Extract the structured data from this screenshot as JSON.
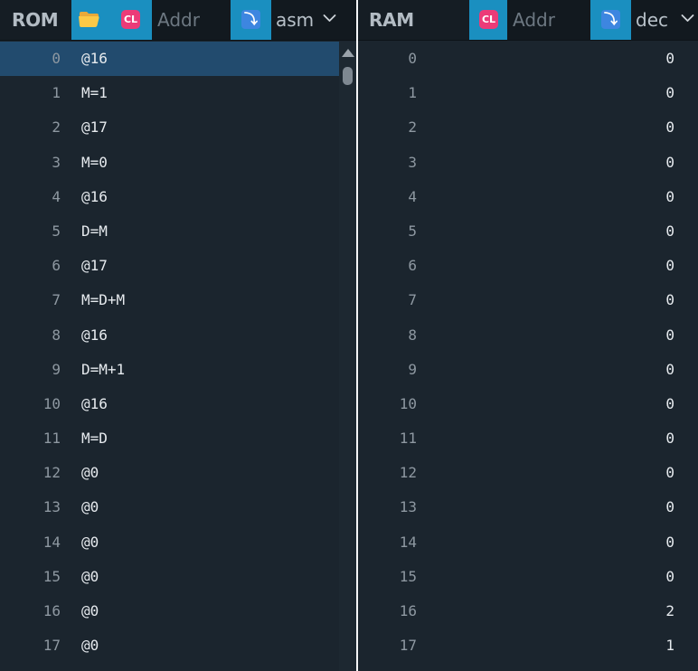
{
  "rom": {
    "title": "ROM",
    "addr_placeholder": "Addr",
    "format": "asm",
    "cl_label": "CL",
    "jump_glyph": "⤵",
    "icons": {
      "load": "folder-icon",
      "clear": "cl-icon",
      "jump": "jump-icon",
      "format": "chevron-down-icon"
    },
    "selected_row": 0,
    "rows": [
      {
        "index": "0",
        "value": "@16"
      },
      {
        "index": "1",
        "value": "M=1"
      },
      {
        "index": "2",
        "value": "@17"
      },
      {
        "index": "3",
        "value": "M=0"
      },
      {
        "index": "4",
        "value": "@16"
      },
      {
        "index": "5",
        "value": "D=M"
      },
      {
        "index": "6",
        "value": "@17"
      },
      {
        "index": "7",
        "value": "M=D+M"
      },
      {
        "index": "8",
        "value": "@16"
      },
      {
        "index": "9",
        "value": "D=M+1"
      },
      {
        "index": "10",
        "value": "@16"
      },
      {
        "index": "11",
        "value": "M=D"
      },
      {
        "index": "12",
        "value": "@0"
      },
      {
        "index": "13",
        "value": "@0"
      },
      {
        "index": "14",
        "value": "@0"
      },
      {
        "index": "15",
        "value": "@0"
      },
      {
        "index": "16",
        "value": "@0"
      },
      {
        "index": "17",
        "value": "@0"
      }
    ]
  },
  "ram": {
    "title": "RAM",
    "addr_placeholder": "Addr",
    "format": "dec",
    "cl_label": "CL",
    "jump_glyph": "⤵",
    "icons": {
      "clear": "cl-icon",
      "jump": "jump-icon",
      "format": "chevron-down-icon"
    },
    "rows": [
      {
        "index": "0",
        "value": "0"
      },
      {
        "index": "1",
        "value": "0"
      },
      {
        "index": "2",
        "value": "0"
      },
      {
        "index": "3",
        "value": "0"
      },
      {
        "index": "4",
        "value": "0"
      },
      {
        "index": "5",
        "value": "0"
      },
      {
        "index": "6",
        "value": "0"
      },
      {
        "index": "7",
        "value": "0"
      },
      {
        "index": "8",
        "value": "0"
      },
      {
        "index": "9",
        "value": "0"
      },
      {
        "index": "10",
        "value": "0"
      },
      {
        "index": "11",
        "value": "0"
      },
      {
        "index": "12",
        "value": "0"
      },
      {
        "index": "13",
        "value": "0"
      },
      {
        "index": "14",
        "value": "0"
      },
      {
        "index": "15",
        "value": "0"
      },
      {
        "index": "16",
        "value": "2"
      },
      {
        "index": "17",
        "value": "1"
      }
    ]
  },
  "colors": {
    "panel_bg": "#1b252e",
    "toolbar_bg": "#151d24",
    "accent": "#1a8fc0",
    "selected_row": "#224b6e",
    "cl_badge": "#ec3b78",
    "jump_badge": "#3d86e0"
  }
}
